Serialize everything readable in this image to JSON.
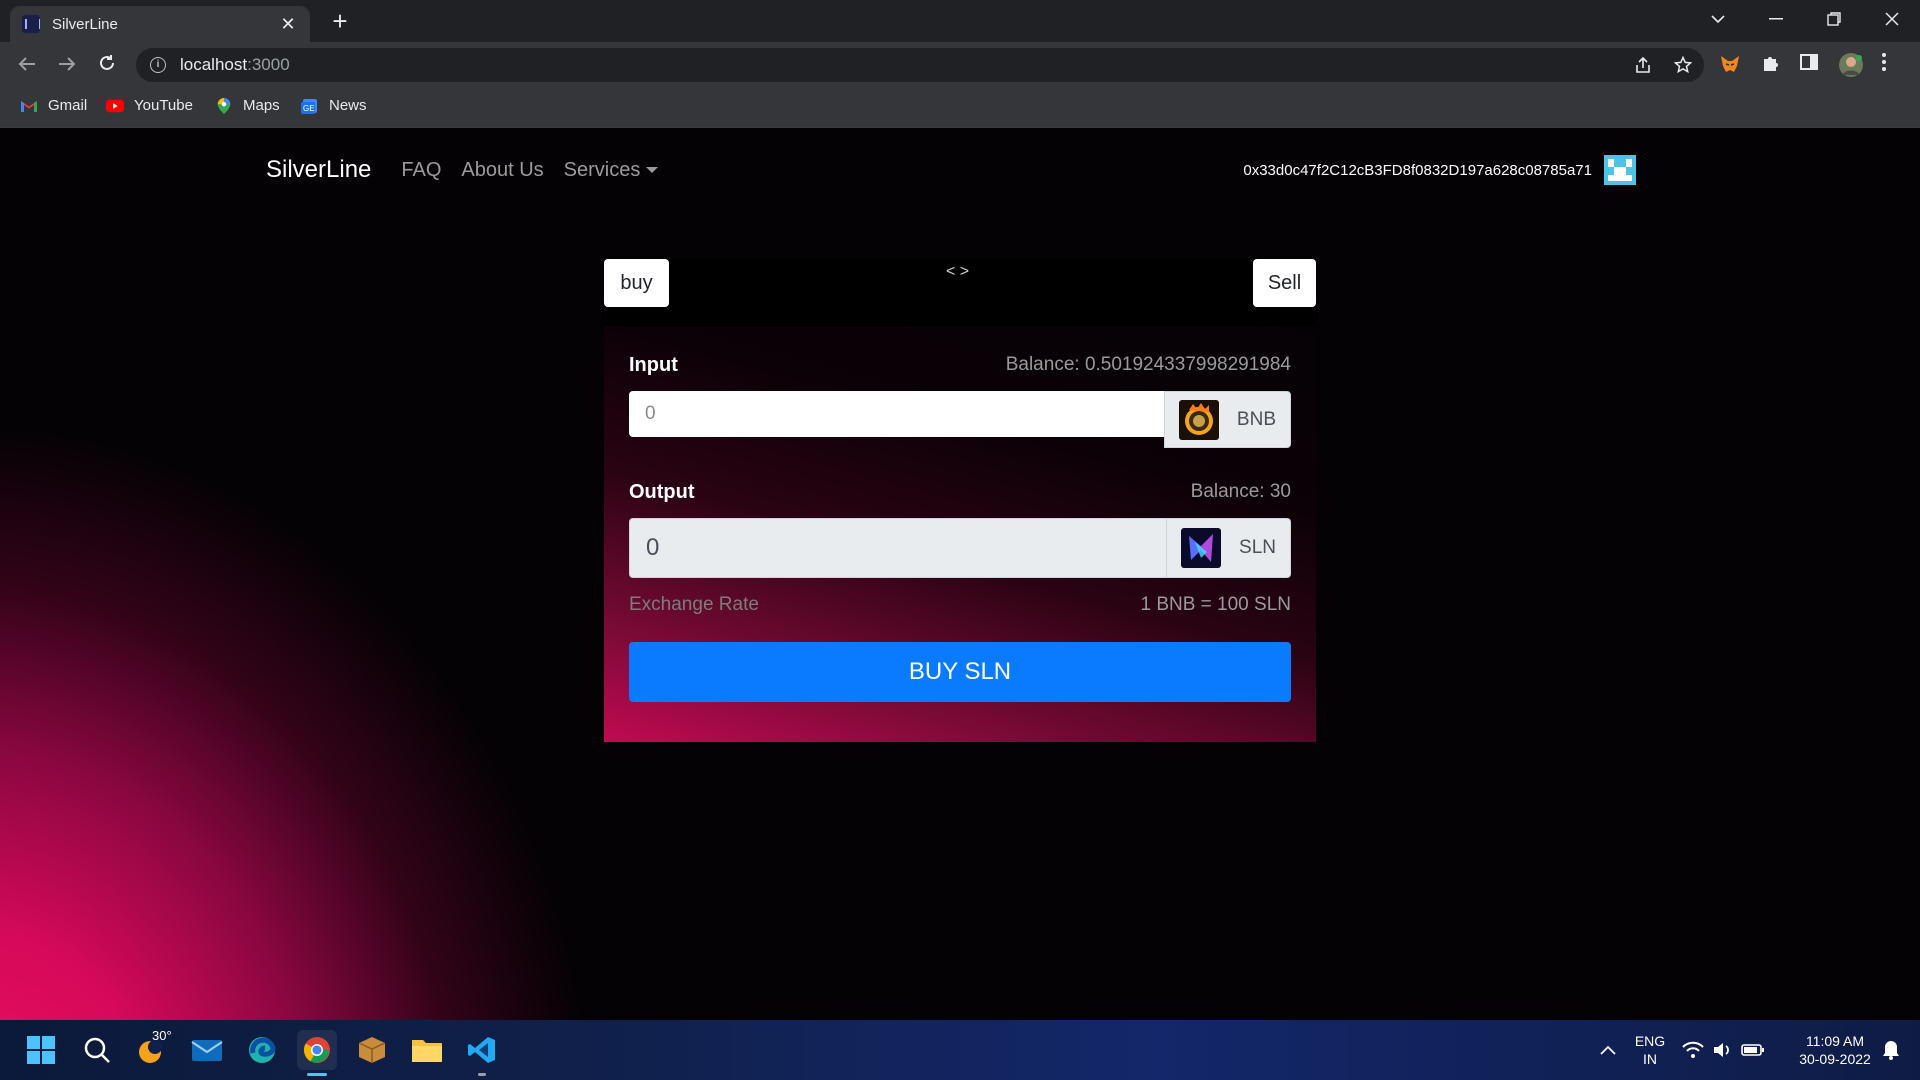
{
  "browser": {
    "tab_title": "SilverLine",
    "tab_close": "✕",
    "new_tab": "+",
    "url_host": "localhost",
    "url_port": ":3000",
    "bookmarks": [
      {
        "label": "Gmail"
      },
      {
        "label": "YouTube"
      },
      {
        "label": "Maps"
      },
      {
        "label": "News"
      }
    ]
  },
  "nav": {
    "brand": "SilverLine",
    "links": [
      "FAQ",
      "About Us",
      "Services"
    ],
    "account_address": "0x33d0c47f2C12cB3FD8f0832D197a628c08785a71"
  },
  "swap": {
    "buy_tab": "buy",
    "sell_tab": "Sell",
    "arrows": "< >",
    "input": {
      "label": "Input",
      "balance": "Balance: 0.501924337998291984",
      "placeholder": "0",
      "token": "BNB"
    },
    "output": {
      "label": "Output",
      "balance": "Balance: 30",
      "value": "0",
      "token": "SLN"
    },
    "rate_label": "Exchange Rate",
    "rate_value": "1 BNB = 100 SLN",
    "submit_label": "BUY SLN"
  },
  "taskbar": {
    "weather": "30°",
    "lang_line1": "ENG",
    "lang_line2": "IN",
    "time": "11:09 AM",
    "date": "30-09-2022"
  },
  "colors": {
    "accent_button": "#0a7bff",
    "page_glow": "#f0105f"
  }
}
